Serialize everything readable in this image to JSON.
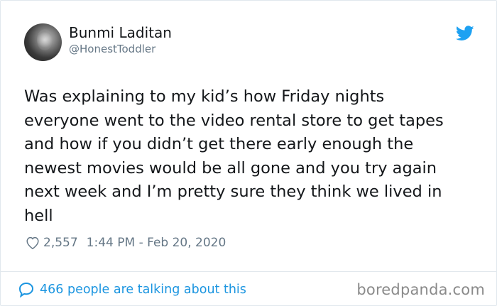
{
  "author": {
    "name": "Bunmi Laditan",
    "handle": "@HonestToddler",
    "avatar_icon": "profile-photo"
  },
  "tweet": {
    "text": "Was explaining to my kid’s how Friday nights\neveryone went to the video rental store to get tapes\nand how if you didn’t get there early enough the\nnewest movies would be all gone and you try again\nnext week and I’m pretty sure they think we lived in\nhell",
    "likes": "2,557",
    "timestamp": "1:44 PM - Feb 20, 2020"
  },
  "footer": {
    "talking_label": "466 people are talking about this",
    "watermark": "boredpanda.com"
  },
  "colors": {
    "twitter_blue": "#1da1f2",
    "link_blue": "#1b95e0",
    "meta_gray": "#657786",
    "text_dark": "#14171a"
  },
  "icons": [
    "twitter-bird-icon",
    "heart-icon",
    "speech-bubble-icon"
  ]
}
